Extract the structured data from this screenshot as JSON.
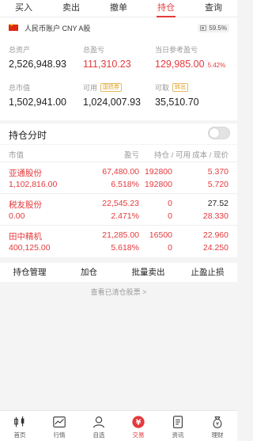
{
  "tabs": [
    {
      "label": "买入",
      "active": false
    },
    {
      "label": "卖出",
      "active": false
    },
    {
      "label": "撤单",
      "active": false
    },
    {
      "label": "持仓",
      "active": true
    },
    {
      "label": "查询",
      "active": false
    }
  ],
  "account": {
    "name": "人民币账户 CNY A股",
    "position_ratio": "59.5%",
    "total_assets_label": "总资产",
    "total_assets": "2,526,948.93",
    "profit_label": "总盈亏",
    "profit": "111,310.23",
    "today_profit_label": "当日参考盈亏",
    "today_profit": "129,985.00",
    "today_profit_pct": "5.42%",
    "market_value_label": "总市值",
    "market_value": "1,502,941.00",
    "available_label": "可用",
    "available_tag": "国债券",
    "available": "1,024,007.93",
    "withdrawable_label": "可取",
    "withdrawable_tag": "转出",
    "withdrawable": "35,510.70"
  },
  "toggle": {
    "label": "持仓分时",
    "on": false
  },
  "table": {
    "headers": {
      "market_value": "市值",
      "profit": "盈亏",
      "holdings": "持仓 / 可用",
      "cost": "成本 / 现价"
    },
    "rows": [
      {
        "name": "亚通股份",
        "market_value": "1,102,816.00",
        "profit": "67,480.00",
        "profit_pct": "6.518%",
        "holding": "192800",
        "available": "192800",
        "cost": "5.370",
        "price": "5.720"
      },
      {
        "name": "税友股份",
        "market_value": "0.00",
        "profit": "22,545.23",
        "profit_pct": "2.471%",
        "holding": "0",
        "available": "0",
        "cost": "27.52",
        "price": "28.330"
      },
      {
        "name": "田中精机",
        "market_value": "400,125.00",
        "profit": "21,285.00",
        "profit_pct": "5.618%",
        "holding": "16500",
        "available": "0",
        "cost": "22.960",
        "price": "24.250"
      }
    ]
  },
  "actions": [
    "持仓管理",
    "加仓",
    "批量卖出",
    "止盈止损"
  ],
  "cleared_link": "查看已清仓股票 >",
  "bottom_nav": [
    {
      "label": "首页",
      "icon": "home-candlestick-icon",
      "active": false
    },
    {
      "label": "行情",
      "icon": "market-chart-icon",
      "active": false
    },
    {
      "label": "自选",
      "icon": "watchlist-person-icon",
      "active": false
    },
    {
      "label": "交易",
      "icon": "trade-coin-icon",
      "active": true
    },
    {
      "label": "资讯",
      "icon": "news-document-icon",
      "active": false
    },
    {
      "label": "理财",
      "icon": "wealth-money-bag-icon",
      "active": false
    }
  ],
  "colors": {
    "accent": "#e4393c",
    "muted": "#999999",
    "background": "#f4f4f4"
  }
}
